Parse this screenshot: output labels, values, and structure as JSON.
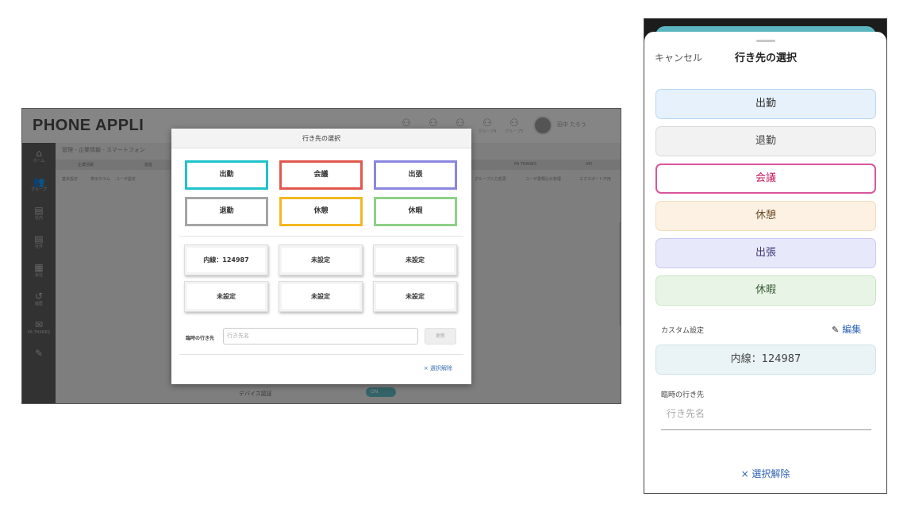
{
  "desktop": {
    "brand": "PHONE APPLI",
    "header_icons": [
      {
        "icon": "group-icon",
        "caption": ""
      },
      {
        "icon": "group-icon",
        "caption": ""
      },
      {
        "icon": "group-icon",
        "caption": ""
      },
      {
        "icon": "group-icon",
        "caption": "グループ4"
      },
      {
        "icon": "group-icon",
        "caption": "グループ5"
      }
    ],
    "user_name": "田中 たろう",
    "breadcrumb": "管理 - 企業情報 - スマートフォン",
    "tabs": [
      "企業情報",
      "基盤",
      "PA THANKS",
      "API"
    ],
    "subtabs": [
      "基本設定",
      "表示カラム",
      "ユーザ設定",
      "グループ入力変更",
      "ユーザ書類込み管理",
      "エクスポート不用"
    ],
    "side_nav": [
      {
        "icon": "home-icon",
        "label": "ホーム"
      },
      {
        "icon": "group-icon",
        "label": "グループ"
      },
      {
        "icon": "directory-icon",
        "label": "社内"
      },
      {
        "icon": "directory-icon",
        "label": "社外"
      },
      {
        "icon": "building-icon",
        "label": "会社"
      },
      {
        "icon": "history-icon",
        "label": "履歴"
      },
      {
        "icon": "thanks-icon",
        "label": "PA THANKS"
      },
      {
        "icon": "wrench-icon",
        "label": ""
      }
    ],
    "device_auth_label": "デバイス認証",
    "toggle_label": "ON",
    "modal": {
      "title": "行き先の選択",
      "status_buttons": [
        {
          "label": "出勤",
          "color": "#1fc3cb"
        },
        {
          "label": "会議",
          "color": "#e0584d"
        },
        {
          "label": "出張",
          "color": "#8b86e0"
        },
        {
          "label": "退勤",
          "color": "#a5a5a5"
        },
        {
          "label": "休憩",
          "color": "#f5b721"
        },
        {
          "label": "休暇",
          "color": "#8ed087"
        }
      ],
      "custom_buttons": [
        "内線：124987",
        "未設定",
        "未設定",
        "未設定",
        "未設定",
        "未設定"
      ],
      "temp_label": "臨時の行き先",
      "temp_placeholder": "行き先名",
      "update_label": "更新",
      "clear_label": "× 選択解除"
    }
  },
  "mobile": {
    "cancel_label": "キャンセル",
    "title": "行き先の選択",
    "options": [
      {
        "label": "出勤",
        "bg": "#e6f1fb",
        "border": "#b9d6f1",
        "text": "#333333"
      },
      {
        "label": "退勤",
        "bg": "#f2f2f2",
        "border": "#d9d9d9",
        "text": "#444444"
      },
      {
        "label": "会議",
        "bg": "#ffffff",
        "border": "#d9559c",
        "text": "#c2185b",
        "selected": true
      },
      {
        "label": "休憩",
        "bg": "#fdf1e3",
        "border": "#f3dbbd",
        "text": "#6b4e2a"
      },
      {
        "label": "出張",
        "bg": "#e8e8fb",
        "border": "#c9c9f2",
        "text": "#3a3a6e"
      },
      {
        "label": "休暇",
        "bg": "#e8f5e6",
        "border": "#c8e6c3",
        "text": "#3a5a36"
      }
    ],
    "custom_label": "カスタム設定",
    "edit_label": "編集",
    "custom_value": "内線：124987",
    "temp_label": "臨時の行き先",
    "temp_placeholder": "行き先名",
    "clear_label": "× 選択解除"
  }
}
